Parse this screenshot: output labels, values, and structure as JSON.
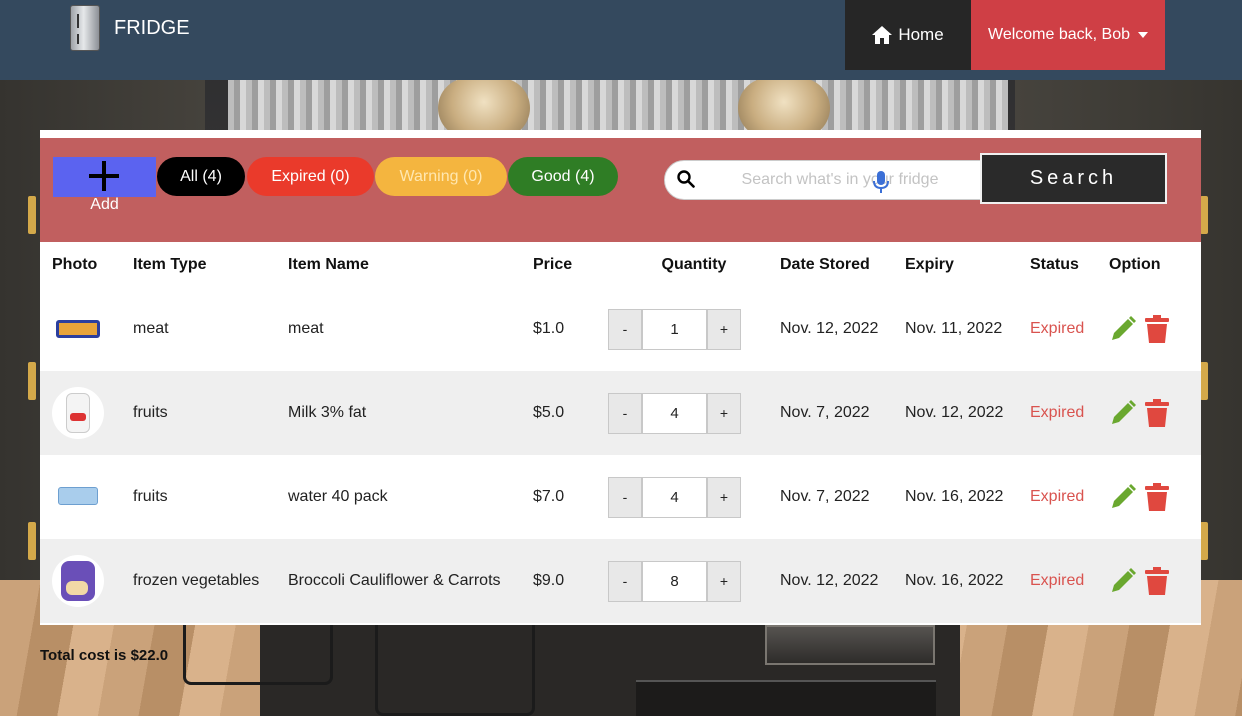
{
  "app": {
    "brand": "FRIDGE",
    "icons": {
      "brand": "fridge-icon",
      "home": "home-icon",
      "user_menu": "caret-down-icon"
    }
  },
  "nav": {
    "home_label": "Home",
    "user_label": "Welcome back, Bob"
  },
  "toolbar": {
    "add_label": "Add",
    "filters": {
      "all": "All (4)",
      "expired": "Expired (0)",
      "warning": "Warning (0)",
      "good": "Good (4)"
    },
    "search_placeholder": "Search what's in your fridge",
    "search_button": "Search"
  },
  "table": {
    "headers": {
      "photo": "Photo",
      "type": "Item Type",
      "name": "Item Name",
      "price": "Price",
      "quantity": "Quantity",
      "stored": "Date Stored",
      "expiry": "Expiry",
      "status": "Status",
      "option": "Option"
    },
    "rows": [
      {
        "type": "meat",
        "name": "meat",
        "price": "$1.0",
        "quantity": "1",
        "stored": "Nov. 12, 2022",
        "expiry": "Nov. 11, 2022",
        "status": "Expired"
      },
      {
        "type": "fruits",
        "name": "Milk 3% fat",
        "price": "$5.0",
        "quantity": "4",
        "stored": "Nov. 7, 2022",
        "expiry": "Nov. 12, 2022",
        "status": "Expired"
      },
      {
        "type": "fruits",
        "name": "water 40 pack",
        "price": "$7.0",
        "quantity": "4",
        "stored": "Nov. 7, 2022",
        "expiry": "Nov. 16, 2022",
        "status": "Expired"
      },
      {
        "type": "frozen vegetables",
        "name": "Broccoli Cauliflower & Carrots",
        "price": "$9.0",
        "quantity": "8",
        "stored": "Nov. 12, 2022",
        "expiry": "Nov. 16, 2022",
        "status": "Expired"
      }
    ],
    "stepper": {
      "minus": "-",
      "plus": "+"
    }
  },
  "footer": {
    "total": "Total cost is $22.0"
  },
  "colors": {
    "navbar": "#34495e",
    "home_bg": "#262626",
    "user_bg": "#cf3f45",
    "toolbar_bg": "#c15f5f",
    "add_bg": "#5b63f0",
    "filter_all": "#000000",
    "filter_expired": "#ea3a2b",
    "filter_warning": "#f4b53f",
    "filter_good": "#2f7d25",
    "status_expired": "#d9534f",
    "edit_icon": "#6aa82f",
    "delete_icon": "#e0483f"
  }
}
